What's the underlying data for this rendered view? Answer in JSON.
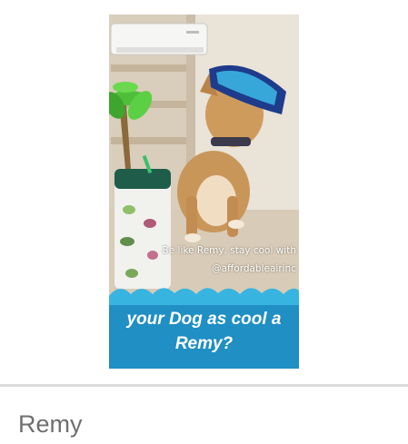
{
  "story": {
    "caption_line1": "Be like Remy, stay cool with",
    "caption_line2": "@affordableairinc",
    "banner_line1": "your Dog as cool a",
    "banner_line2": "Remy?",
    "colors": {
      "banner_blue": "#1f8fc4",
      "wave_light": "#38b4e0",
      "wall": "#e6dfd4"
    }
  },
  "post": {
    "title": "Remy"
  }
}
